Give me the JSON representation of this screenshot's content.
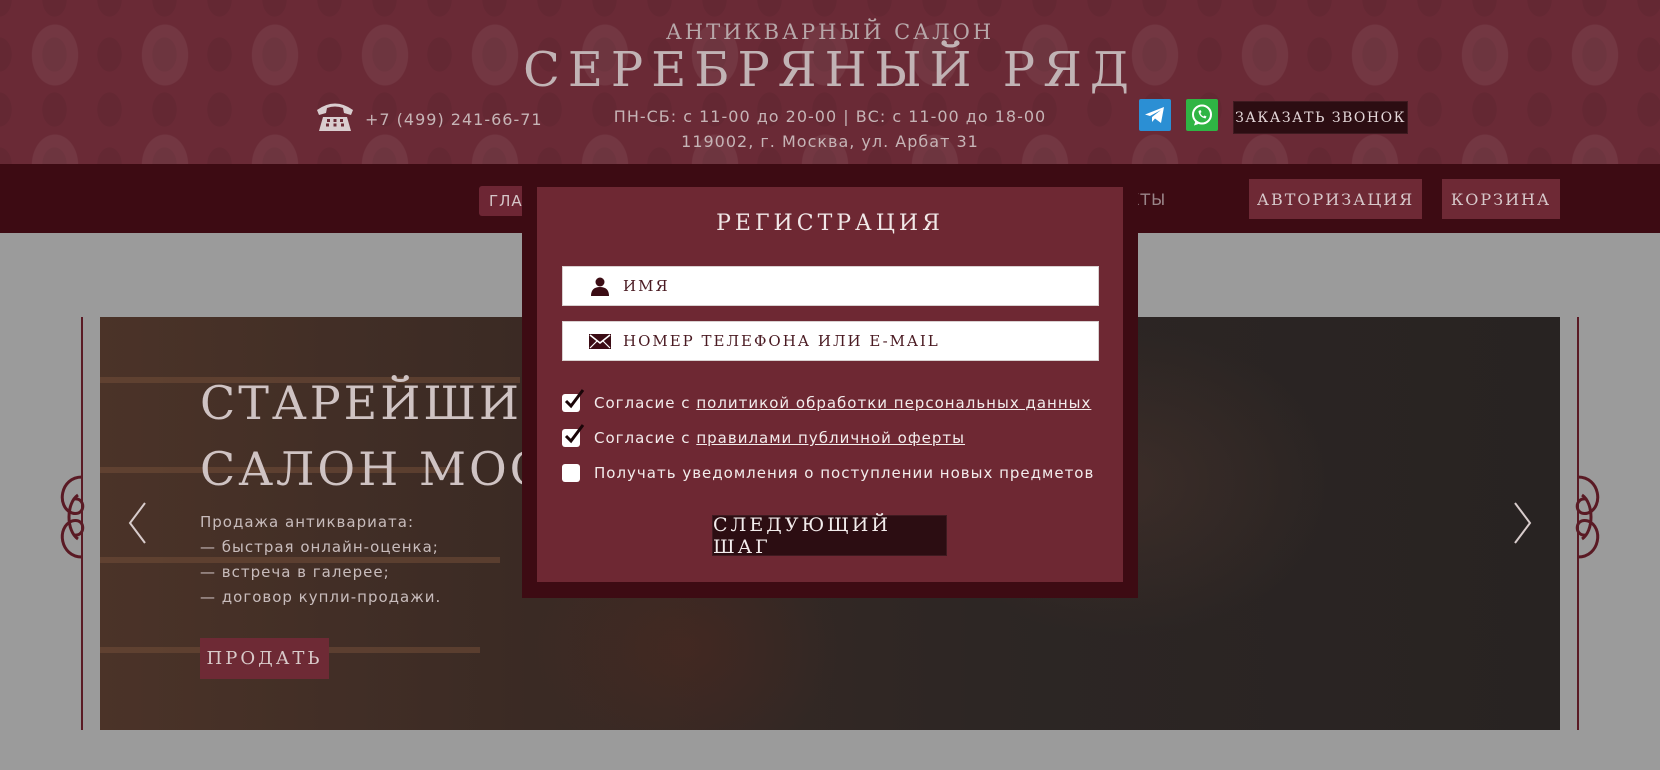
{
  "header": {
    "brand_subtitle": "Антикварный салон",
    "brand_title": "Серебряный ряд",
    "phone": "+7 (499) 241-66-71",
    "hours": "ПН-СБ: с 11-00 до 20-00 | ВС: с 11-00 до 18-00",
    "address": "119002, г. Москва, ул. Арбат 31",
    "call_button": "Заказать звонок",
    "icons": [
      "phone-icon",
      "telegram-icon",
      "whatsapp-icon"
    ]
  },
  "nav": {
    "home_label": "ГЛАВНАЯ",
    "contacts_label": "КТЫ",
    "auth_label": "Авторизация",
    "cart_label": "Корзина"
  },
  "slide": {
    "title": "Старейший\nсалон Мос",
    "lines": [
      "Продажа антиквариата:",
      "— быстрая онлайн-оценка;",
      "— встреча в галерее;",
      "— договор купли-продажи."
    ],
    "sell_button": "Продать"
  },
  "modal": {
    "title": "Регистрация",
    "name_placeholder": "Имя",
    "contact_placeholder": "Номер телефона или e-mail",
    "consent_personal_prefix": "Согласие с ",
    "consent_personal_link": "политикой обработки персональных данных",
    "consent_personal_checked": true,
    "consent_offer_prefix": "Согласие с ",
    "consent_offer_link": "правилами публичной оферты",
    "consent_offer_checked": true,
    "notifications_label": "Получать уведомления о поступлении новых предметов",
    "notifications_checked": false,
    "next_button": "Следующий шаг"
  },
  "colors": {
    "header_bg": "#6a2a36",
    "nav_bg": "#3d0b13",
    "modal_bg": "#6e2833",
    "button_dark": "#2c0d12",
    "accent_button": "#6e2935",
    "telegram": "#2b8fd4",
    "whatsapp": "#2fb544"
  }
}
